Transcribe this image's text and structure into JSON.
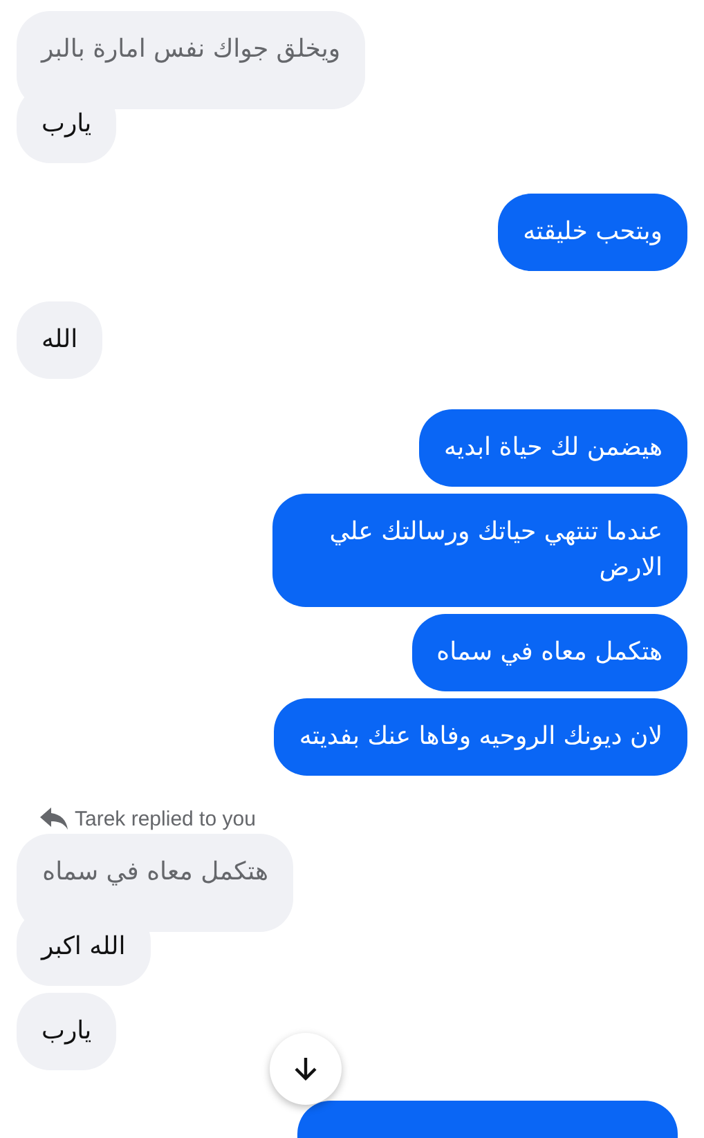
{
  "groups": [
    {
      "outgoing": false,
      "messages": [
        {
          "kind": "quoted",
          "text": "ويخلق جواك نفس امارة بالبر"
        },
        {
          "kind": "plain",
          "text": "يارب"
        }
      ]
    },
    {
      "outgoing": true,
      "messages": [
        {
          "kind": "plain",
          "text": "وبتحب خليقته"
        }
      ]
    },
    {
      "outgoing": false,
      "messages": [
        {
          "kind": "plain",
          "text": "الله"
        }
      ]
    },
    {
      "outgoing": true,
      "messages": [
        {
          "kind": "plain",
          "text": "هيضمن لك حياة ابديه"
        },
        {
          "kind": "plain",
          "text": "عندما تنتهي حياتك ورسالتك علي الارض"
        },
        {
          "kind": "plain",
          "text": "هتكمل معاه في سماه"
        },
        {
          "kind": "plain",
          "text": "لان ديونك الروحيه وفاها عنك بفديته"
        }
      ]
    },
    {
      "outgoing": false,
      "reply_note": "Tarek replied to you",
      "messages": [
        {
          "kind": "quoted",
          "text": "هتكمل معاه في سماه"
        },
        {
          "kind": "plain",
          "text": "الله اكبر"
        },
        {
          "kind": "plain",
          "text": "يارب"
        }
      ]
    },
    {
      "outgoing": true,
      "messages": [
        {
          "kind": "cut"
        }
      ]
    }
  ]
}
